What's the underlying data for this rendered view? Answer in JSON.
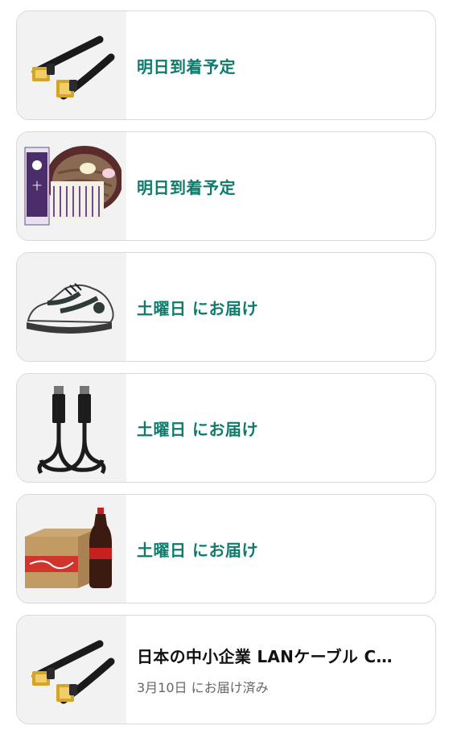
{
  "orders": [
    {
      "icon": "lan-cable-icon",
      "status": "明日到着予定"
    },
    {
      "icon": "soba-noodles-icon",
      "status": "明日到着予定"
    },
    {
      "icon": "sneaker-icon",
      "status": "土曜日 にお届け"
    },
    {
      "icon": "hdmi-cable-icon",
      "status": "土曜日 にお届け"
    },
    {
      "icon": "cola-box-icon",
      "status": "土曜日 にお届け"
    },
    {
      "icon": "lan-cable-icon",
      "title": "日本の中小企業 LANケーブル C…",
      "status": "3月10日 にお届け済み"
    }
  ],
  "colors": {
    "status_green": "#0f7b6c",
    "delivered_gray": "#666666",
    "card_border": "#d9d9d9",
    "thumb_bg": "#f2f2f2"
  }
}
